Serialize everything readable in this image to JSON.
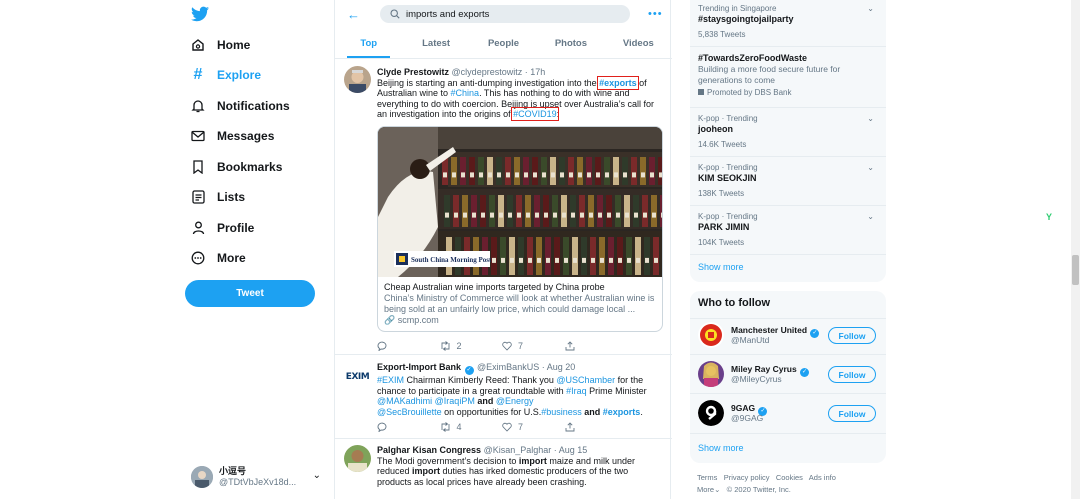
{
  "nav": {
    "items": [
      {
        "label": "Home",
        "icon": "home-icon"
      },
      {
        "label": "Explore",
        "icon": "hash-icon"
      },
      {
        "label": "Notifications",
        "icon": "bell-icon"
      },
      {
        "label": "Messages",
        "icon": "envelope-icon"
      },
      {
        "label": "Bookmarks",
        "icon": "bookmark-icon"
      },
      {
        "label": "Lists",
        "icon": "list-icon"
      },
      {
        "label": "Profile",
        "icon": "person-icon"
      },
      {
        "label": "More",
        "icon": "more-circle-icon"
      }
    ],
    "tweet_button": "Tweet",
    "account": {
      "name": "小逗号",
      "handle": "@TDtVbJeXv18d..."
    }
  },
  "search": {
    "query": "imports and exports"
  },
  "tabs": [
    "Top",
    "Latest",
    "People",
    "Photos",
    "Videos"
  ],
  "tweets": [
    {
      "name": "Clyde Prestowitz",
      "handle": "@clydeprestowitz",
      "time": "· 17h",
      "text": {
        "p1": "Beijing is starting an anti-dumping investigation into the ",
        "tag1": "#exports",
        "p2": " of Australian wine to ",
        "tag2": "#China",
        "p3": ". This has nothing to do with wine and everything to do with coercion. Beijing is upset over Australia’s call for an investigation into the origins of ",
        "tag3": "#COVID19",
        "p4": ":"
      },
      "card": {
        "brand": "South China Morning Post",
        "title": "Cheap Australian wine imports targeted by China probe",
        "desc": "China’s Ministry of Commerce will look at whether Australian wine is being sold at an unfairly low price, which could damage local ...",
        "link": "scmp.com"
      },
      "counts": {
        "reply": "",
        "retweet": "2",
        "like": "7"
      }
    },
    {
      "name": "Export-Import Bank",
      "handle": "@EximBankUS",
      "time": "· Aug 20",
      "avatar_text": "EXIM",
      "text": {
        "t1": "#EXIM",
        "p1": " Chairman Kimberly Reed: Thank you ",
        "t2": "@USChamber",
        "p2": " for the chance to participate in a great roundtable with ",
        "t3": "#Iraq",
        "p3": " Prime Minister ",
        "t4": "@MAKadhimi",
        "t5": "@IraqiPM",
        "p4": " and ",
        "t6": "@Energy",
        "t7": "@SecBrouillette",
        "p5": " on opportunities for U.S.",
        "t8": "#business",
        "p6": " and ",
        "t9": "#exports",
        "p7": "."
      },
      "counts": {
        "reply": "",
        "retweet": "4",
        "like": "7"
      }
    },
    {
      "name": "Palghar Kisan Congress",
      "handle": "@Kisan_Palghar",
      "time": "· Aug 15",
      "text": {
        "p1": "The Modi government’s decision to ",
        "b1": "import",
        "p2": " maize and milk under reduced ",
        "b2": "import",
        "p3": " duties has irked domestic producers of the two products as local prices have already been crashing."
      }
    }
  ],
  "trends": [
    {
      "context": "Trending in Singapore",
      "title": "#staysgoingtojailparty",
      "count": "5,838 Tweets"
    },
    {
      "title": "#TowardsZeroFoodWaste",
      "desc": "Building a more food secure future for generations to come",
      "promoted": "Promoted by DBS Bank"
    },
    {
      "context": "K-pop · Trending",
      "title": "jooheon",
      "count": "14.6K Tweets"
    },
    {
      "context": "K-pop · Trending",
      "title": "KIM SEOKJIN",
      "count": "138K Tweets"
    },
    {
      "context": "K-pop · Trending",
      "title": "PARK JIMIN",
      "count": "104K Tweets"
    }
  ],
  "trends_show_more": "Show more",
  "who_to_follow": {
    "title": "Who to follow",
    "users": [
      {
        "name": "Manchester United",
        "handle": "@ManUtd"
      },
      {
        "name": "Miley Ray Cyrus",
        "handle": "@MileyCyrus"
      },
      {
        "name": "9GAG",
        "handle": "@9GAG"
      }
    ],
    "follow_label": "Follow",
    "show_more": "Show more"
  },
  "footer": {
    "terms": "Terms",
    "privacy": "Privacy policy",
    "cookies": "Cookies",
    "ads": "Ads info",
    "more": "More",
    "copyright": "© 2020 Twitter, Inc."
  },
  "colors": {
    "accent": "#1da1f2",
    "highlight_box": "#e0201b"
  }
}
